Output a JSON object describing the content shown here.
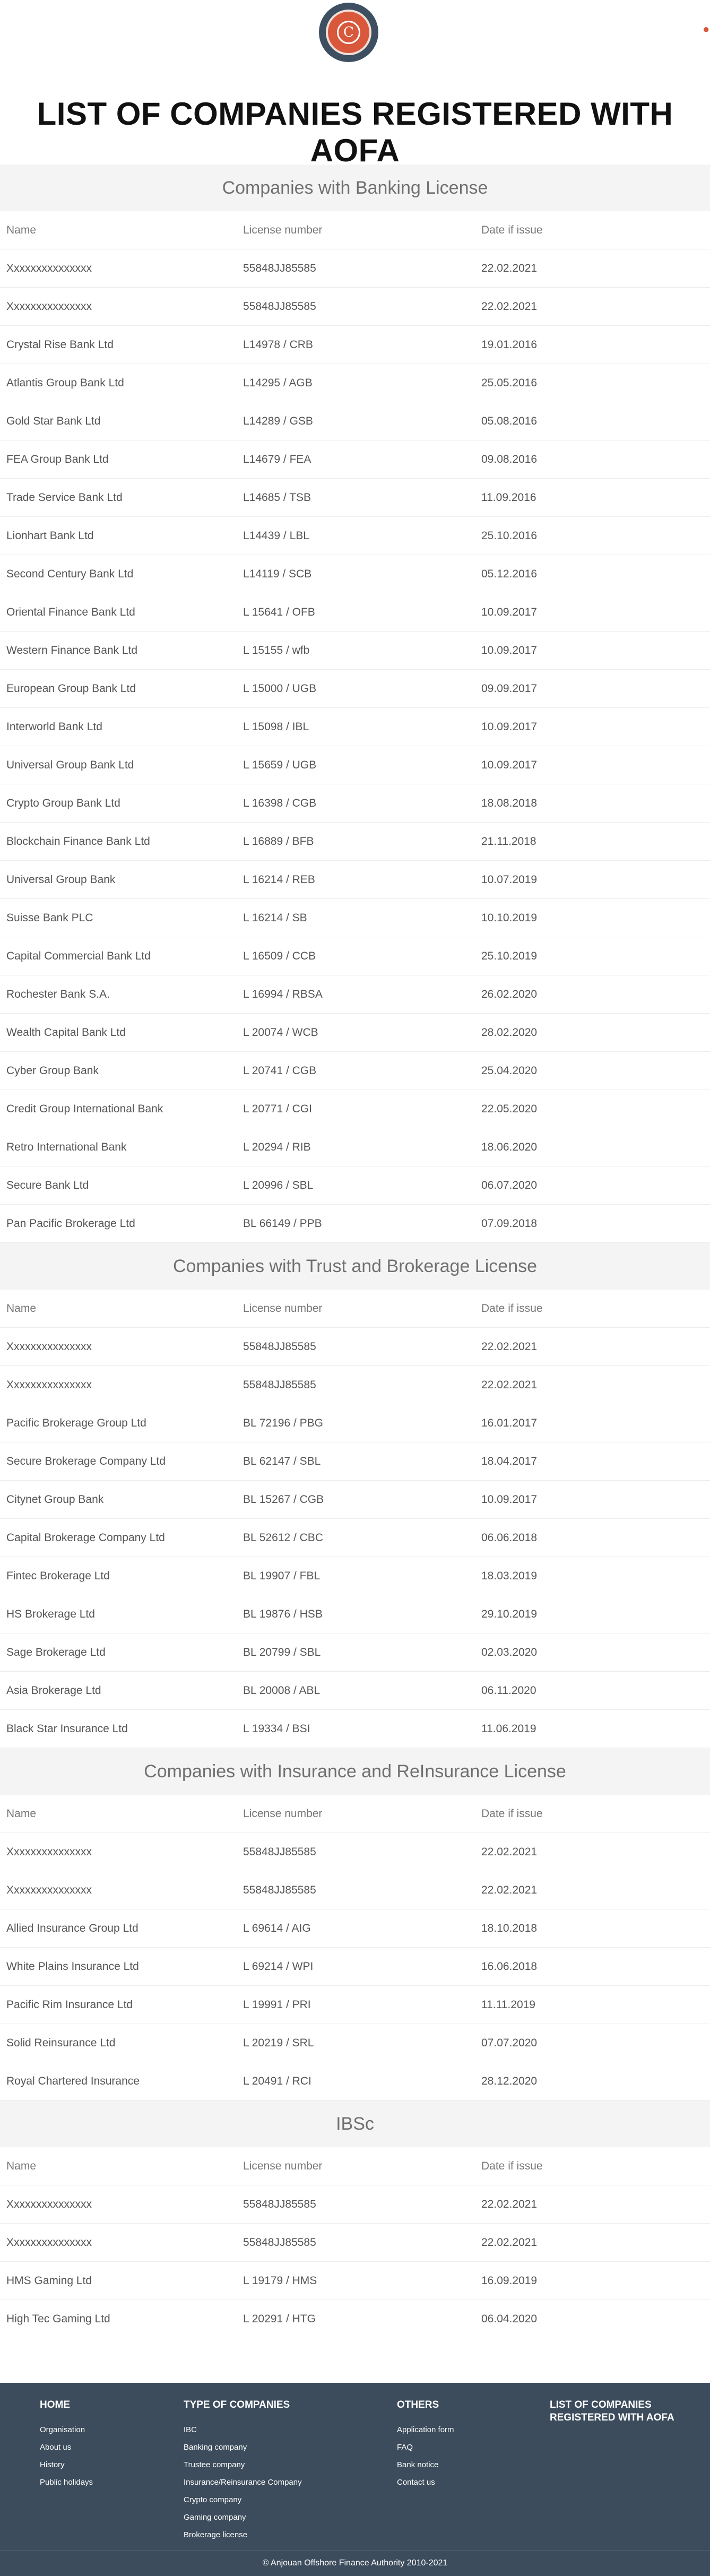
{
  "header": {
    "logo_letter": "C",
    "title": "LIST OF COMPANIES REGISTERED WITH AOFA"
  },
  "columns": {
    "name": "Name",
    "license": "License number",
    "date": "Date if issue"
  },
  "sections": [
    {
      "title": "Companies with Banking License",
      "rows": [
        [
          "Xxxxxxxxxxxxxxx",
          "55848JJ85585",
          "22.02.2021"
        ],
        [
          "Xxxxxxxxxxxxxxx",
          "55848JJ85585",
          "22.02.2021"
        ],
        [
          "Crystal Rise Bank Ltd",
          "L14978 / CRB",
          "19.01.2016"
        ],
        [
          "Atlantis Group Bank Ltd",
          "L14295 / AGB",
          "25.05.2016"
        ],
        [
          "Gold Star Bank Ltd",
          "L14289 / GSB",
          "05.08.2016"
        ],
        [
          "FEA Group Bank Ltd",
          "L14679 / FEA",
          "09.08.2016"
        ],
        [
          "Trade Service Bank Ltd",
          "L14685 / TSB",
          "11.09.2016"
        ],
        [
          "Lionhart Bank Ltd",
          "L14439 / LBL",
          "25.10.2016"
        ],
        [
          "Second Century Bank Ltd",
          "L14119 / SCB",
          "05.12.2016"
        ],
        [
          "Oriental Finance Bank Ltd",
          "L 15641 / OFB",
          "10.09.2017"
        ],
        [
          "Western Finance Bank Ltd",
          "L 15155 / wfb",
          "10.09.2017"
        ],
        [
          "European Group Bank Ltd",
          "L 15000 / UGB",
          "09.09.2017"
        ],
        [
          "Interworld Bank Ltd",
          "L 15098 / IBL",
          "10.09.2017"
        ],
        [
          "Universal Group Bank Ltd",
          "L 15659 / UGB",
          "10.09.2017"
        ],
        [
          "Crypto Group Bank Ltd",
          "L 16398 / CGB",
          "18.08.2018"
        ],
        [
          "Blockchain Finance Bank Ltd",
          "L 16889 / BFB",
          "21.11.2018"
        ],
        [
          "Universal Group Bank",
          "L 16214 / REB",
          "10.07.2019"
        ],
        [
          "Suisse Bank PLC",
          "L 16214 / SB",
          "10.10.2019"
        ],
        [
          "Capital Commercial Bank Ltd",
          "L 16509 / CCB",
          "25.10.2019"
        ],
        [
          "Rochester Bank S.A.",
          "L 16994 / RBSA",
          "26.02.2020"
        ],
        [
          "Wealth Capital Bank Ltd",
          "L 20074 / WCB",
          "28.02.2020"
        ],
        [
          "Cyber Group Bank",
          "L 20741 / CGB",
          "25.04.2020"
        ],
        [
          "Credit Group International Bank",
          "L 20771 / CGI",
          "22.05.2020"
        ],
        [
          "Retro International Bank",
          "L 20294 / RIB",
          "18.06.2020"
        ],
        [
          "Secure Bank Ltd",
          "L 20996 / SBL",
          "06.07.2020"
        ],
        [
          "Pan Pacific Brokerage Ltd",
          "BL 66149 / PPB",
          "07.09.2018"
        ]
      ]
    },
    {
      "title": "Companies with Trust and Brokerage License",
      "rows": [
        [
          "Xxxxxxxxxxxxxxx",
          "55848JJ85585",
          "22.02.2021"
        ],
        [
          "Xxxxxxxxxxxxxxx",
          "55848JJ85585",
          "22.02.2021"
        ],
        [
          "Pacific Brokerage Group Ltd",
          "BL 72196 / PBG",
          "16.01.2017"
        ],
        [
          "Secure Brokerage Company Ltd",
          "BL 62147 / SBL",
          "18.04.2017"
        ],
        [
          "Citynet Group Bank",
          "BL 15267 / CGB",
          "10.09.2017"
        ],
        [
          "Capital Brokerage Company Ltd",
          "BL 52612 / CBC",
          "06.06.2018"
        ],
        [
          "Fintec Brokerage Ltd",
          "BL 19907 / FBL",
          "18.03.2019"
        ],
        [
          "HS Brokerage Ltd",
          "BL 19876 / HSB",
          "29.10.2019"
        ],
        [
          "Sage Brokerage Ltd",
          "BL 20799 / SBL",
          "02.03.2020"
        ],
        [
          "Asia Brokerage Ltd",
          "BL 20008 / ABL",
          "06.11.2020"
        ],
        [
          "Black Star Insurance Ltd",
          "L 19334 / BSI",
          "11.06.2019"
        ]
      ]
    },
    {
      "title": "Companies with Insurance and ReInsurance License",
      "rows": [
        [
          "Xxxxxxxxxxxxxxx",
          "55848JJ85585",
          "22.02.2021"
        ],
        [
          "Xxxxxxxxxxxxxxx",
          "55848JJ85585",
          "22.02.2021"
        ],
        [
          "Allied Insurance Group Ltd",
          "L 69614 / AIG",
          "18.10.2018"
        ],
        [
          "White Plains Insurance Ltd",
          "L 69214 / WPI",
          "16.06.2018"
        ],
        [
          "Pacific Rim Insurance Ltd",
          "L 19991 / PRI",
          "11.11.2019"
        ],
        [
          "Solid Reinsurance Ltd",
          "L 20219 / SRL",
          "07.07.2020"
        ],
        [
          "Royal Chartered Insurance",
          "L 20491 / RCI",
          "28.12.2020"
        ]
      ]
    },
    {
      "title": "IBSc",
      "rows": [
        [
          "Xxxxxxxxxxxxxxx",
          "55848JJ85585",
          "22.02.2021"
        ],
        [
          "Xxxxxxxxxxxxxxx",
          "55848JJ85585",
          "22.02.2021"
        ],
        [
          "HMS Gaming Ltd",
          "L 19179 / HMS",
          "16.09.2019"
        ],
        [
          "High Tec Gaming Ltd",
          "L 20291 / HTG",
          "06.04.2020"
        ]
      ]
    }
  ],
  "footer": {
    "columns": [
      {
        "heading": "HOME",
        "links": [
          "Organisation",
          "About us",
          "History",
          "Public holidays"
        ]
      },
      {
        "heading": "TYPE OF COMPANIES",
        "links": [
          "IBC",
          "Banking company",
          "Trustee company",
          "Insurance/Reinsurance Company",
          "Crypto company",
          "Gaming company",
          "Brokerage license"
        ]
      },
      {
        "heading": "OTHERS",
        "links": [
          "Application form",
          "FAQ",
          "Bank notice",
          "Contact us"
        ]
      },
      {
        "heading": "LIST OF COMPANIES REGISTERED WITH AOFA",
        "links": []
      }
    ],
    "copyright": "© Anjouan Offshore Finance Authority 2010-2021"
  },
  "colors": {
    "accent": "#d9573b",
    "footer_bg": "#3c4c5c",
    "section_bg": "#f4f4f4"
  }
}
